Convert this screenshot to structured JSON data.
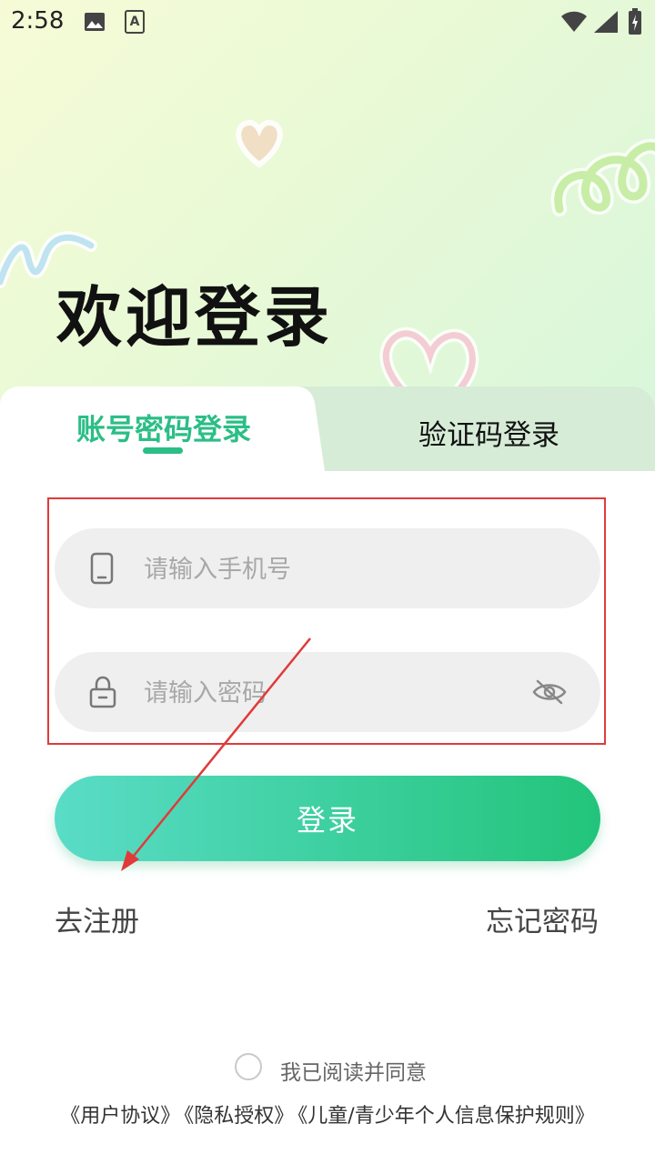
{
  "status_bar": {
    "time": "2:58",
    "icons": [
      "image-icon",
      "text-a-icon",
      "wifi-icon",
      "signal-icon",
      "battery-icon"
    ]
  },
  "header": {
    "title": "欢迎登录"
  },
  "tabs": [
    {
      "label": "账号密码登录",
      "active": true
    },
    {
      "label": "验证码登录",
      "active": false
    }
  ],
  "form": {
    "phone": {
      "placeholder": "请输入手机号",
      "value": "",
      "icon": "phone-icon"
    },
    "password": {
      "placeholder": "请输入密码",
      "value": "",
      "icon": "lock-icon",
      "toggle_icon": "eye-off-icon"
    },
    "login_label": "登录",
    "register_label": "去注册",
    "forgot_label": "忘记密码"
  },
  "agreement": {
    "label": "我已阅读并同意",
    "checked": false,
    "links": [
      "《用户协议》",
      "《隐私授权》",
      "《儿童/青少年个人信息保护规则》"
    ]
  },
  "colors": {
    "accent": "#2bbe86",
    "button_gradient_start": "#5adcc7",
    "button_gradient_end": "#22c47a",
    "annotation": "#e03a3a"
  }
}
